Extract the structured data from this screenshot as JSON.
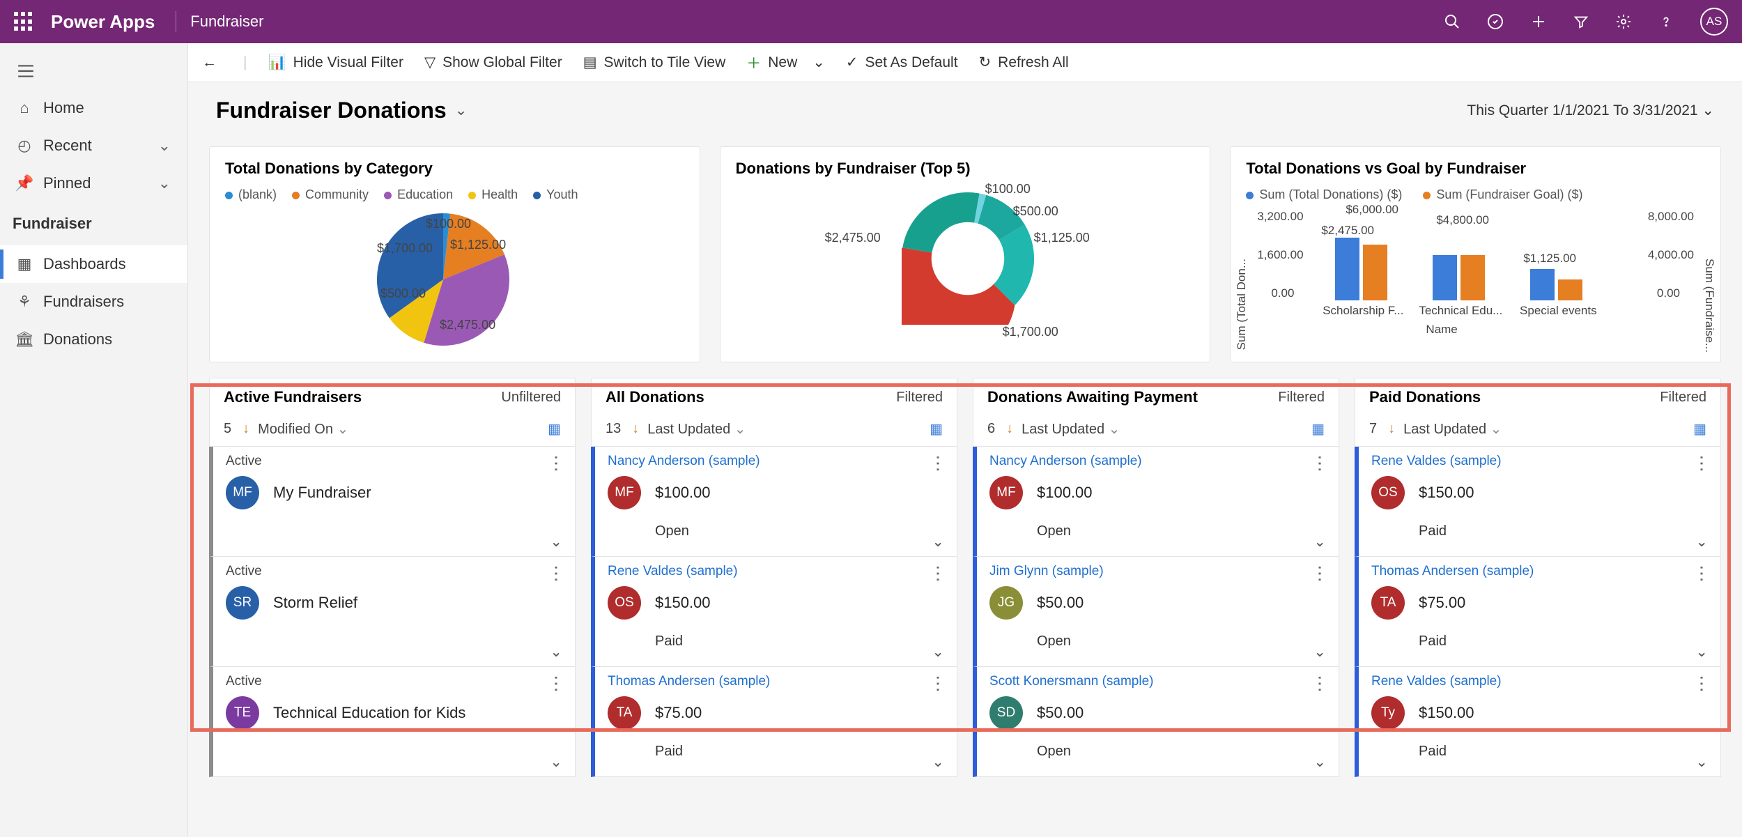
{
  "titlebar": {
    "brand": "Power Apps",
    "app": "Fundraiser",
    "avatar": "AS"
  },
  "leftnav": {
    "home": "Home",
    "recent": "Recent",
    "pinned": "Pinned",
    "group": "Fundraiser",
    "dashboards": "Dashboards",
    "fundraisers": "Fundraisers",
    "donations": "Donations"
  },
  "cmdbar": {
    "hide_visual": "Hide Visual Filter",
    "show_global": "Show Global Filter",
    "tile_view": "Switch to Tile View",
    "new": "New",
    "set_default": "Set As Default",
    "refresh": "Refresh All"
  },
  "page": {
    "title": "Fundraiser Donations",
    "range": "This Quarter 1/1/2021 To 3/31/2021"
  },
  "chart1": {
    "title": "Total Donations by Category",
    "legend": [
      "(blank)",
      "Community",
      "Education",
      "Health",
      "Youth"
    ],
    "labels": [
      "$100.00",
      "$1,125.00",
      "$1,700.00",
      "$500.00",
      "$2,475.00"
    ]
  },
  "chart2": {
    "title": "Donations by Fundraiser (Top 5)",
    "labels": [
      "$100.00",
      "$500.00",
      "$1,125.00",
      "$2,475.00",
      "$1,700.00"
    ]
  },
  "chart3": {
    "title": "Total Donations vs Goal by Fundraiser",
    "legend": [
      "Sum (Total Donations) ($)",
      "Sum (Fundraiser Goal) ($)"
    ],
    "leftaxis_title": "Sum (Total Don...",
    "rightaxis_title": "Sum (Fundraise...",
    "leftaxis": [
      "3,200.00",
      "1,600.00",
      "0.00"
    ],
    "rightaxis": [
      "8,000.00",
      "4,000.00",
      "0.00"
    ],
    "xcats": [
      "Scholarship F...",
      "Technical Edu...",
      "Special events"
    ],
    "xtitle": "Name",
    "barlabels": [
      "$2,475.00",
      "$6,000.00",
      "$4,800.00",
      "$1,125.00"
    ]
  },
  "chart_data": [
    {
      "type": "pie",
      "title": "Total Donations by Category",
      "series": [
        {
          "name": "(blank)",
          "value": 100.0
        },
        {
          "name": "Community",
          "value": 1125.0
        },
        {
          "name": "Education",
          "value": 2475.0
        },
        {
          "name": "Health",
          "value": 500.0
        },
        {
          "name": "Youth",
          "value": 1700.0
        }
      ]
    },
    {
      "type": "pie",
      "title": "Donations by Fundraiser (Top 5)",
      "values": [
        100.0,
        500.0,
        1125.0,
        2475.0,
        1700.0
      ]
    },
    {
      "type": "bar",
      "title": "Total Donations vs Goal by Fundraiser",
      "categories": [
        "Scholarship F...",
        "Technical Edu...",
        "Special events"
      ],
      "series": [
        {
          "name": "Sum (Total Donations) ($)",
          "values": [
            2475.0,
            null,
            1125.0
          ]
        },
        {
          "name": "Sum (Fundraiser Goal) ($)",
          "values": [
            6000.0,
            4800.0,
            null
          ]
        }
      ],
      "left_ylim": [
        0,
        3200
      ],
      "right_ylim": [
        0,
        8000
      ]
    }
  ],
  "streams": [
    {
      "title": "Active Fundraisers",
      "filter": "Unfiltered",
      "count": "5",
      "sort": "Modified On",
      "accent": "#8c8c8e",
      "items": [
        {
          "top": "Active",
          "av": "MF",
          "avcolor": "#2860a8",
          "name": "My Fundraiser",
          "status": "",
          "link": false
        },
        {
          "top": "Active",
          "av": "SR",
          "avcolor": "#2860a8",
          "name": "Storm Relief",
          "status": "",
          "link": false
        },
        {
          "top": "Active",
          "av": "TE",
          "avcolor": "#7b3aa0",
          "name": "Technical Education for Kids",
          "status": "",
          "link": false
        }
      ]
    },
    {
      "title": "All Donations",
      "filter": "Filtered",
      "count": "13",
      "sort": "Last Updated",
      "accent": "#2d5dd8",
      "items": [
        {
          "top": "Nancy Anderson (sample)",
          "av": "MF",
          "avcolor": "#b12c2c",
          "name": "$100.00",
          "status": "Open",
          "link": true
        },
        {
          "top": "Rene Valdes (sample)",
          "av": "OS",
          "avcolor": "#b12c2c",
          "name": "$150.00",
          "status": "Paid",
          "link": true
        },
        {
          "top": "Thomas Andersen (sample)",
          "av": "TA",
          "avcolor": "#b12c2c",
          "name": "$75.00",
          "status": "Paid",
          "link": true
        }
      ]
    },
    {
      "title": "Donations Awaiting Payment",
      "filter": "Filtered",
      "count": "6",
      "sort": "Last Updated",
      "accent": "#2d5dd8",
      "items": [
        {
          "top": "Nancy Anderson (sample)",
          "av": "MF",
          "avcolor": "#b12c2c",
          "name": "$100.00",
          "status": "Open",
          "link": true
        },
        {
          "top": "Jim Glynn (sample)",
          "av": "JG",
          "avcolor": "#8a8f37",
          "name": "$50.00",
          "status": "Open",
          "link": true
        },
        {
          "top": "Scott Konersmann (sample)",
          "av": "SD",
          "avcolor": "#2f7d6f",
          "name": "$50.00",
          "status": "Open",
          "link": true
        }
      ]
    },
    {
      "title": "Paid Donations",
      "filter": "Filtered",
      "count": "7",
      "sort": "Last Updated",
      "accent": "#2d5dd8",
      "items": [
        {
          "top": "Rene Valdes (sample)",
          "av": "OS",
          "avcolor": "#b12c2c",
          "name": "$150.00",
          "status": "Paid",
          "link": true
        },
        {
          "top": "Thomas Andersen (sample)",
          "av": "TA",
          "avcolor": "#b12c2c",
          "name": "$75.00",
          "status": "Paid",
          "link": true
        },
        {
          "top": "Rene Valdes (sample)",
          "av": "Ty",
          "avcolor": "#b12c2c",
          "name": "$150.00",
          "status": "Paid",
          "link": true
        }
      ]
    }
  ]
}
